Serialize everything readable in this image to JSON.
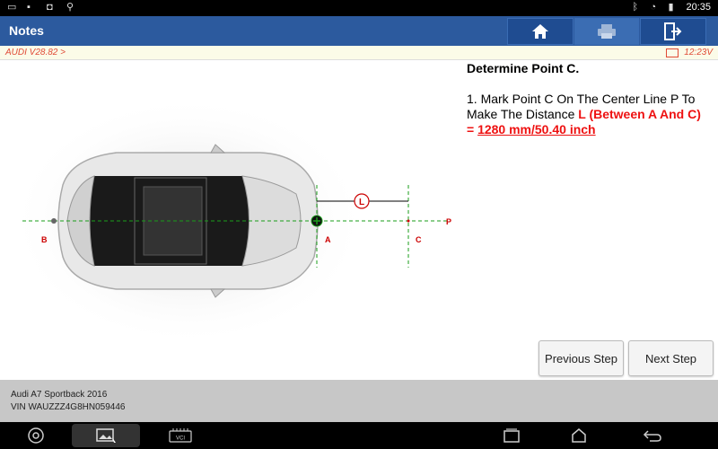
{
  "status": {
    "time": "20:35"
  },
  "header": {
    "title": "Notes"
  },
  "info": {
    "version": "AUDI V28.82 >",
    "voltage": "12:23V"
  },
  "content": {
    "heading": "Determine Point C.",
    "instruction_prefix": "1. Mark Point C On The Center Line P To Make The Distance ",
    "instruction_highlight": "L (Between A And C)",
    "instruction_eq": "= ",
    "instruction_value": "1280 mm/50.40 inch"
  },
  "diagram": {
    "label_b": "B",
    "label_a": "A",
    "label_c": "C",
    "label_p": "P",
    "label_l": "L"
  },
  "buttons": {
    "previous": "Previous Step",
    "next": "Next Step"
  },
  "vehicle": {
    "model": "Audi A7 Sportback 2016",
    "vin": "VIN WAUZZZ4G8HN059446"
  },
  "androidbar": {
    "vci_label": "VCI"
  }
}
